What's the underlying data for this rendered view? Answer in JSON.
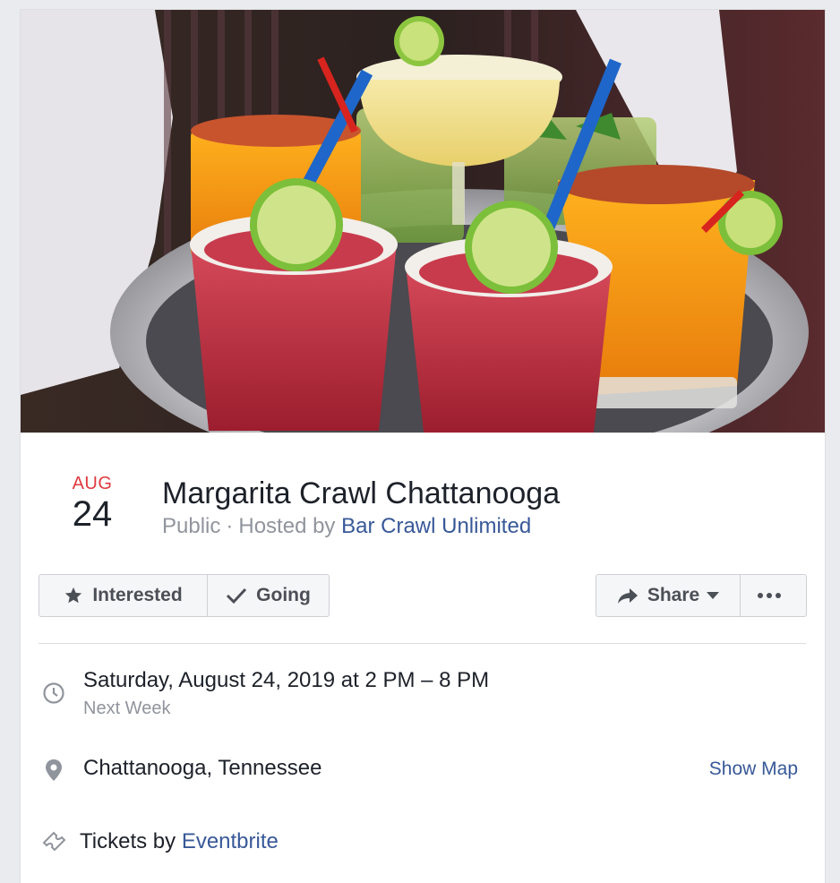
{
  "event": {
    "month": "AUG",
    "day": "24",
    "title": "Margarita Crawl Chattanooga",
    "privacy": "Public",
    "separator": "·",
    "hosted_by_prefix": "Hosted by",
    "host_name": "Bar Crawl Unlimited"
  },
  "actions": {
    "interested_label": "Interested",
    "going_label": "Going",
    "share_label": "Share"
  },
  "details": {
    "datetime": "Saturday, August 24, 2019 at 2 PM – 8 PM",
    "relative_time": "Next Week",
    "location": "Chattanooga, Tennessee",
    "show_map_label": "Show Map",
    "tickets_prefix": "Tickets by",
    "tickets_provider": "Eventbrite"
  },
  "icons": {
    "interested": "star-icon",
    "going": "check-icon",
    "share": "share-arrow-icon",
    "more": "more-dots-icon",
    "time": "clock-icon",
    "location": "map-pin-icon",
    "tickets": "ticket-icon"
  },
  "colors": {
    "date_month": "#e0393e",
    "link": "#385898",
    "secondary_text": "#90949c",
    "button_bg": "#f5f6f7"
  }
}
